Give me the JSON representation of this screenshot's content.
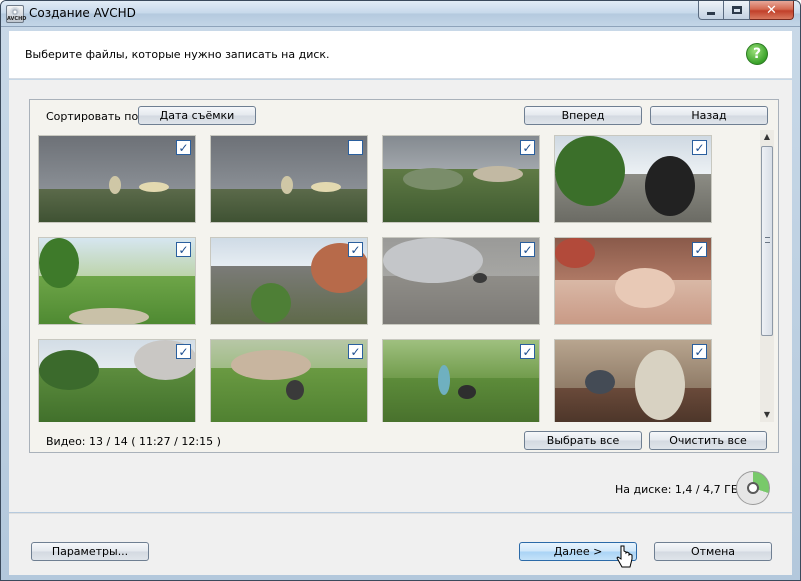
{
  "window": {
    "title": "Создание AVCHD",
    "icon": "avchd-disc-icon",
    "icon_text": "AVCHD",
    "close_symbol": "✕"
  },
  "header": {
    "instruction": "Выберите файлы, которые нужно записать на диск.",
    "help_symbol": "?"
  },
  "toolbar": {
    "sort_label": "Сортировать по:",
    "sort_value": "Дата съёмки",
    "forward_label": "Вперед",
    "back_label": "Назад"
  },
  "thumbnails": [
    {
      "checked": true,
      "scene": "cloudy-city-church"
    },
    {
      "checked": false,
      "scene": "cloudy-city-church"
    },
    {
      "checked": true,
      "scene": "city-panorama-trees"
    },
    {
      "checked": true,
      "scene": "baby-stroller-park"
    },
    {
      "checked": true,
      "scene": "playground-swings"
    },
    {
      "checked": true,
      "scene": "street-walkway"
    },
    {
      "checked": true,
      "scene": "silver-car-cat"
    },
    {
      "checked": true,
      "scene": "baby-sleeping"
    },
    {
      "checked": true,
      "scene": "apartment-yard"
    },
    {
      "checked": true,
      "scene": "garden-path-stroller"
    },
    {
      "checked": true,
      "scene": "park-woman-stroller"
    },
    {
      "checked": true,
      "scene": "woman-with-child-indoors"
    }
  ],
  "checkbox_mark": "✓",
  "status": {
    "video_summary": "Видео: 13 / 14 ( 11:27 / 12:15 )",
    "select_all_label": "Выбрать все",
    "clear_all_label": "Очистить все"
  },
  "disk": {
    "usage_text": "На диске: 1,4 / 4,7 ГБ",
    "fill_fraction": 0.3,
    "fill_color": "#78c96a"
  },
  "footer": {
    "settings_label": "Параметры...",
    "next_label": "Далее >",
    "cancel_label": "Отмена"
  },
  "colors": {
    "titlebar": "#c6d8ea",
    "checkbox_border": "#2a5f9e",
    "help_green": "#3aa22a"
  }
}
